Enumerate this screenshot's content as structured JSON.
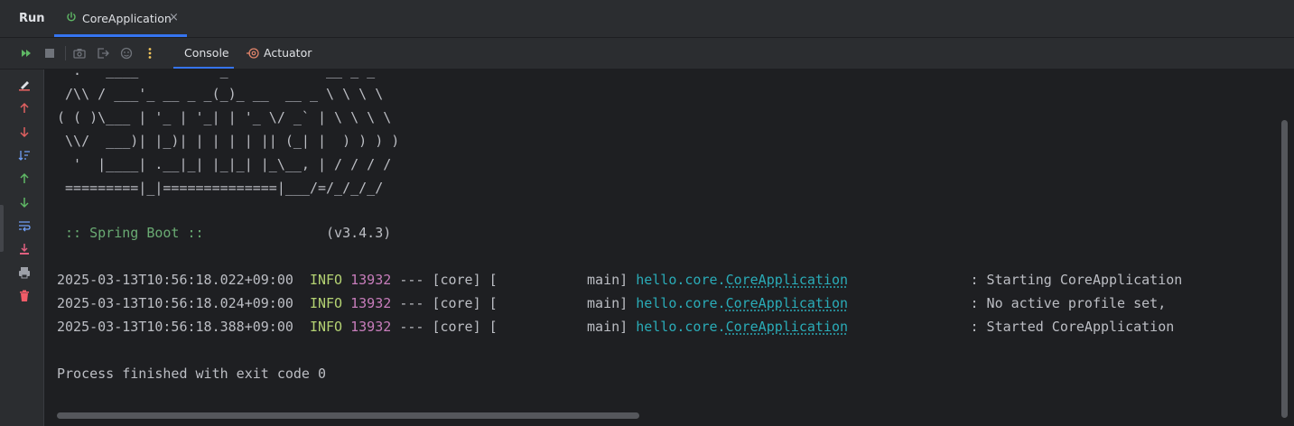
{
  "window": {
    "run_label": "Run",
    "tab_name": "CoreApplication",
    "tab_close": "×"
  },
  "toolbar": {
    "icons": [
      "rerun-icon",
      "stop-icon",
      "camera-icon",
      "exit-icon",
      "settings-icon",
      "more-icon"
    ],
    "console_tab": "Console",
    "actuator_tab": "Actuator"
  },
  "gutter": {
    "icons": [
      "clear-icon",
      "up-icon",
      "down-icon",
      "sort-icon",
      "previous-icon",
      "next-icon",
      "wrap-icon",
      "scroll-end-icon",
      "print-icon",
      "trash-icon"
    ]
  },
  "console": {
    "banner": [
      "  .   ____          _            __ _ _",
      " /\\\\ / ___'_ __ _ _(_)_ __  __ _ \\ \\ \\ \\",
      "( ( )\\___ | '_ | '_| | '_ \\/ _` | \\ \\ \\ \\",
      " \\\\/  ___)| |_)| | | | | || (_| |  ) ) ) )",
      "  '  |____| .__|_| |_|_| |_\\__, | / / / /",
      " =========|_|==============|___/=/_/_/_/"
    ],
    "spring_label": " :: Spring Boot :: ",
    "spring_padding": "              ",
    "spring_version": "(v3.4.3)",
    "logs": [
      {
        "timestamp": "2025-03-13T10:56:18.022+09:00",
        "level": "INFO",
        "pid": "13932",
        "sep": "---",
        "app": "[core]",
        "thread": "[           main]",
        "pkg": "hello.core.",
        "cls": "CoreApplication",
        "message": ": Starting CoreApplication"
      },
      {
        "timestamp": "2025-03-13T10:56:18.024+09:00",
        "level": "INFO",
        "pid": "13932",
        "sep": "---",
        "app": "[core]",
        "thread": "[           main]",
        "pkg": "hello.core.",
        "cls": "CoreApplication",
        "message": ": No active profile set,"
      },
      {
        "timestamp": "2025-03-13T10:56:18.388+09:00",
        "level": "INFO",
        "pid": "13932",
        "sep": "---",
        "app": "[core]",
        "thread": "[           main]",
        "pkg": "hello.core.",
        "cls": "CoreApplication",
        "message": ": Started CoreApplication"
      }
    ],
    "finish": "Process finished with exit code 0"
  },
  "colors": {
    "accent": "#3574f0",
    "green": "#6aab73",
    "info": "#b4d273",
    "pid": "#c77dbb",
    "cyan": "#2aacb8"
  }
}
